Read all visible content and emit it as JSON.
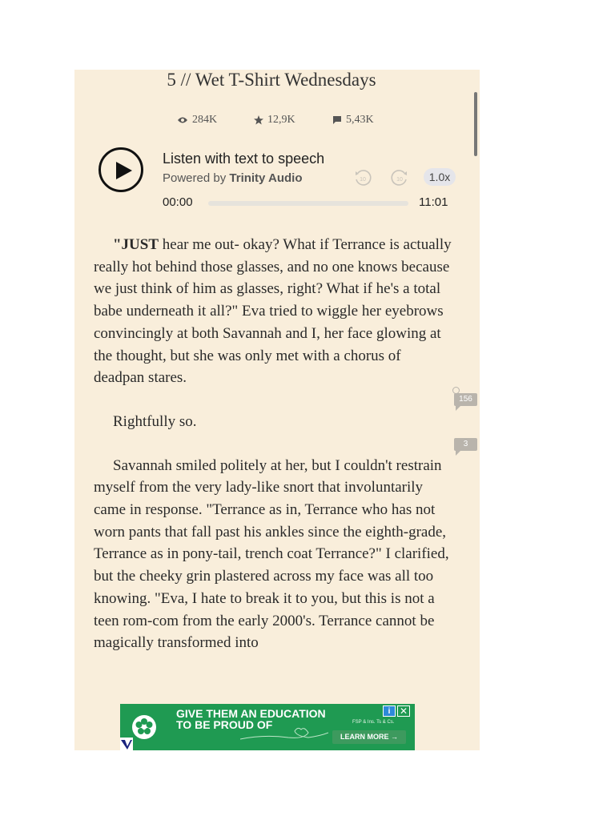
{
  "chapter": {
    "title": "5 // Wet T-Shirt Wednesdays"
  },
  "stats": {
    "views": "284K",
    "votes": "12,9K",
    "comments": "5,43K"
  },
  "audio": {
    "title": "Listen with text to speech",
    "powered_prefix": "Powered by",
    "powered_brand": "Trinity Audio",
    "speed": "1.0x",
    "time_current": "00:00",
    "time_total": "11:01",
    "progress": 0,
    "rewind_label": "10",
    "forward_label": "10"
  },
  "story": {
    "p1_lead": "\"JUST",
    "p1_rest": " hear me out- okay? What if Terrance is actually really hot behind those glasses, and no one knows because we just think of him as glasses, right? What if he's a total babe underneath it all?\" Eva tried to wiggle her eyebrows convincingly at both Savannah and I, her face glowing at the thought, but she was only met with a chorus of deadpan stares.",
    "p2": "Rightfully so.",
    "p3": "Savannah smiled politely at her, but I couldn't restrain myself from the very lady-like snort that involuntarily came in response. \"Terrance as in, Terrance who has not worn pants that fall past his ankles since the eighth-grade, Terrance as in pony-tail, trench coat Terrance?\" I clarified, but the cheeky grin plastered across my face was all too knowing. \"Eva, I hate to break it to you, but this is not a teen rom-com from the early 2000's. Terrance cannot be magically transformed into"
  },
  "inline_comments": {
    "p1_count": "156",
    "p2_count": "3"
  },
  "ad": {
    "headline_line1": "GIVE THEM AN EDUCATION",
    "headline_line2": "TO BE PROUD OF",
    "fine_print": "FSP & Ins. Ts & Cs.",
    "cta": "LEARN MORE →",
    "info_icon": "i",
    "close_icon": "✕"
  },
  "colors": {
    "page_bg": "#f9eedb",
    "ad_green": "#1f9a52",
    "bubble_gray": "#b9b4ac"
  }
}
